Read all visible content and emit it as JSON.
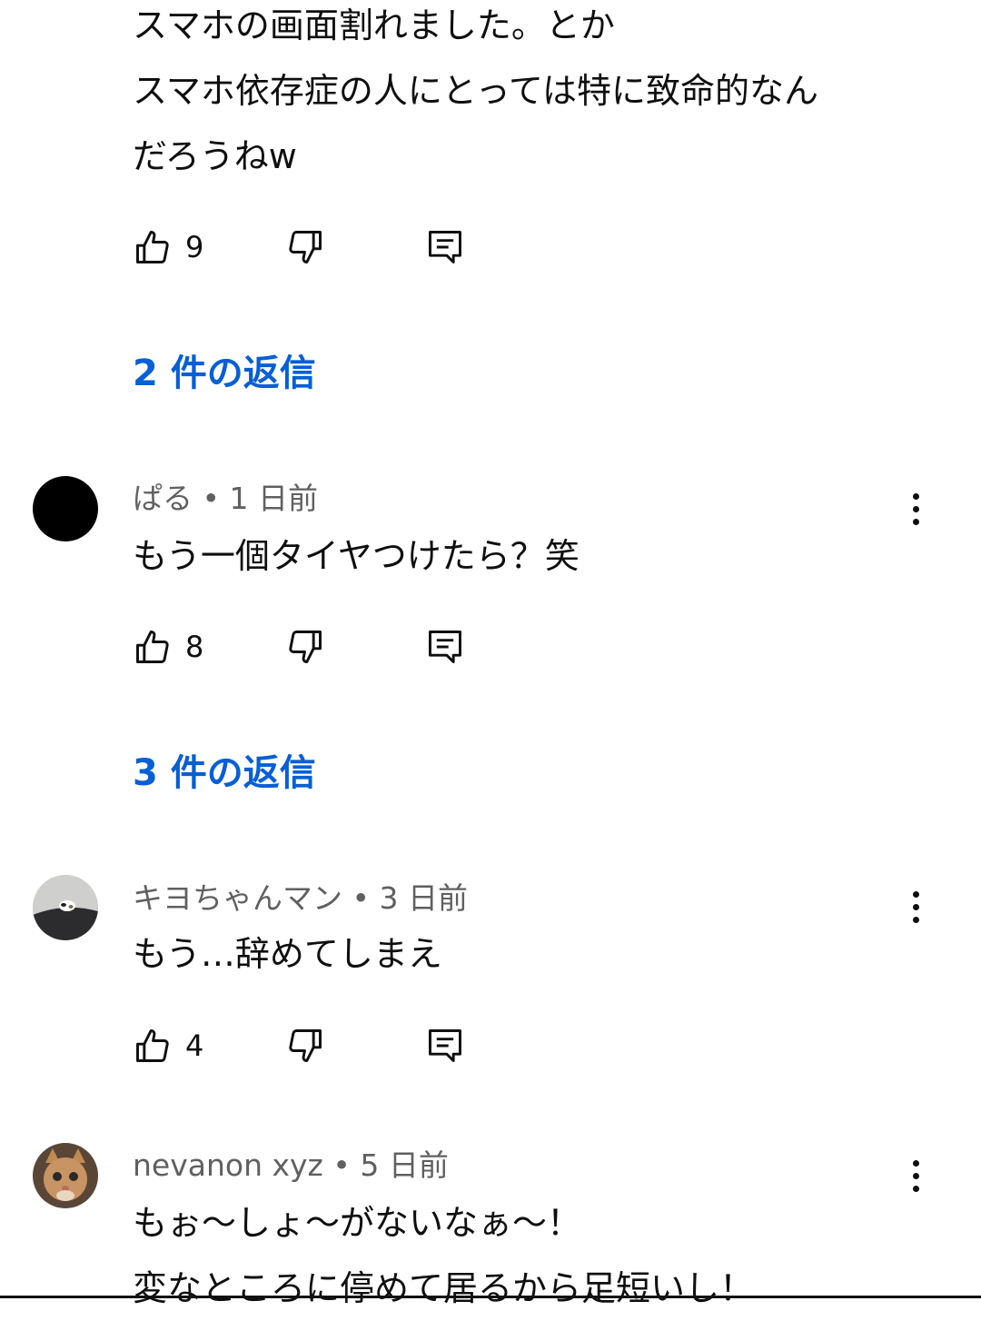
{
  "comments": [
    {
      "lines": [
        "スマホの画面割れました。とか",
        "スマホ依存症の人にとっては特に致命的なん",
        "だろうねw"
      ],
      "likes": "9",
      "replies": "2 件の返信"
    },
    {
      "author": "ぱる",
      "sep": "•",
      "time": "1 日前",
      "lines": [
        "もう一個タイヤつけたら？笑"
      ],
      "likes": "8",
      "replies": "3 件の返信",
      "avatar": "black-circle"
    },
    {
      "author": "キヨちゃんマン",
      "sep": "•",
      "time": "3 日前",
      "lines": [
        "もう…辞めてしまえ"
      ],
      "likes": "4",
      "avatar": "cat-photo"
    },
    {
      "author": "nevanon xyz",
      "sep": "•",
      "time": "5 日前",
      "lines": [
        "もぉ～しょ～がないなぁ～！",
        "変なところに停めて居るから足短いし！"
      ],
      "avatar": "kitten-photo"
    }
  ],
  "colors": {
    "link": "#065fd4",
    "meta": "#606060",
    "text": "#0f0f0f"
  },
  "icons": {
    "like": "thumb-up-icon",
    "dislike": "thumb-down-icon",
    "reply": "comment-icon",
    "menu": "more-vert-icon"
  }
}
